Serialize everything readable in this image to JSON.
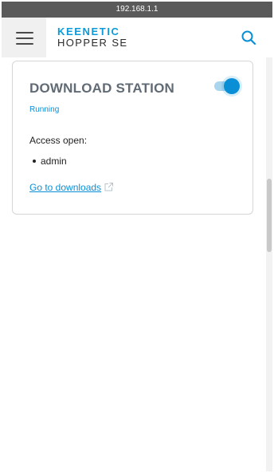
{
  "browser": {
    "url": "192.168.1.1"
  },
  "header": {
    "brand": "KEENETIC",
    "model": "HOPPER SE",
    "menu_icon": "hamburger-menu-icon",
    "search_icon": "search-icon"
  },
  "card": {
    "title": "DOWNLOAD STATION",
    "enabled": true,
    "status": "Running",
    "access_label": "Access open:",
    "users": [
      "admin"
    ],
    "link_label": "Go to downloads",
    "link_icon": "external-link-icon"
  },
  "colors": {
    "accent": "#0a8fd6",
    "brand_blue": "#0a9bd8",
    "title_gray": "#616b75",
    "url_bar": "#5a5a5a",
    "toggle_track": "#a9d6ee"
  }
}
